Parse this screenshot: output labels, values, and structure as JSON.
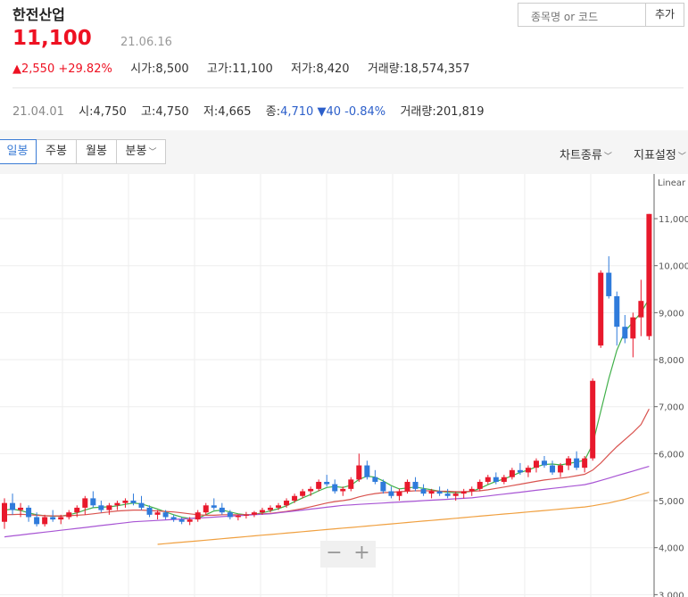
{
  "header": {
    "stock_name": "한전산업",
    "price": "11,100",
    "date": "21.06.16",
    "change": "2,550",
    "change_pct": "+29.82%",
    "open_label": "시가",
    "open": "8,500",
    "high_label": "고가",
    "high": "11,100",
    "low_label": "저가",
    "low": "8,420",
    "volume_label": "거래량",
    "volume": "18,574,357",
    "up_color": "#e8192c"
  },
  "search": {
    "placeholder": "종목명 or 코드",
    "add_label": "추가"
  },
  "hover_row": {
    "date": "21.04.01",
    "open_label": "시",
    "open": "4,750",
    "high_label": "고",
    "high": "4,750",
    "low_label": "저",
    "low": "4,665",
    "close_label": "종",
    "close": "4,710",
    "change": "40",
    "change_pct": "-0.84%",
    "volume_label": "거래량",
    "volume": "201,819",
    "down_color": "#2c5fca"
  },
  "tabs": [
    {
      "label": "일봉",
      "active": true
    },
    {
      "label": "주봉",
      "active": false
    },
    {
      "label": "월봉",
      "active": false
    },
    {
      "label": "분봉",
      "active": false
    }
  ],
  "dropdowns": {
    "chart_type": "차트종류",
    "indicators": "지표설정"
  },
  "chart_data": {
    "type": "candlestick",
    "scale_label": "Linear",
    "y_ticks": [
      3000,
      4000,
      5000,
      6000,
      7000,
      8000,
      9000,
      10000,
      11000
    ],
    "y_tick_labels": [
      "3,000",
      "4,000",
      "5,000",
      "6,000",
      "7,000",
      "8,000",
      "9,000",
      "10,000",
      "11,000"
    ],
    "ylim": [
      2950,
      11950
    ],
    "grid": true,
    "up_color": "#e8192c",
    "down_color": "#2f7bdb",
    "candles": [
      [
        4550,
        5050,
        4400,
        4950
      ],
      [
        4950,
        5150,
        4700,
        4800
      ],
      [
        4800,
        4950,
        4650,
        4850
      ],
      [
        4850,
        4900,
        4550,
        4650
      ],
      [
        4650,
        4750,
        4450,
        4500
      ],
      [
        4500,
        4700,
        4450,
        4650
      ],
      [
        4650,
        4800,
        4550,
        4600
      ],
      [
        4600,
        4700,
        4500,
        4650
      ],
      [
        4650,
        4800,
        4600,
        4750
      ],
      [
        4750,
        4900,
        4650,
        4850
      ],
      [
        4850,
        5100,
        4700,
        5050
      ],
      [
        5050,
        5200,
        4850,
        4900
      ],
      [
        4900,
        5000,
        4750,
        4800
      ],
      [
        4800,
        4950,
        4700,
        4900
      ],
      [
        4900,
        5000,
        4800,
        4950
      ],
      [
        4950,
        5050,
        4850,
        5000
      ],
      [
        5000,
        5150,
        4900,
        4950
      ],
      [
        4950,
        5100,
        4800,
        4850
      ],
      [
        4850,
        4900,
        4650,
        4700
      ],
      [
        4700,
        4800,
        4600,
        4750
      ],
      [
        4750,
        4800,
        4600,
        4650
      ],
      [
        4650,
        4700,
        4550,
        4600
      ],
      [
        4600,
        4650,
        4500,
        4550
      ],
      [
        4550,
        4650,
        4480,
        4600
      ],
      [
        4600,
        4800,
        4550,
        4750
      ],
      [
        4750,
        4950,
        4700,
        4900
      ],
      [
        4900,
        5050,
        4800,
        4850
      ],
      [
        4850,
        4950,
        4700,
        4750
      ],
      [
        4750,
        4800,
        4600,
        4650
      ],
      [
        4650,
        4700,
        4580,
        4680
      ],
      [
        4680,
        4760,
        4620,
        4700
      ],
      [
        4700,
        4780,
        4650,
        4750
      ],
      [
        4750,
        4850,
        4700,
        4800
      ],
      [
        4800,
        4900,
        4750,
        4850
      ],
      [
        4850,
        4950,
        4800,
        4900
      ],
      [
        4900,
        5050,
        4850,
        5000
      ],
      [
        5000,
        5150,
        4950,
        5100
      ],
      [
        5100,
        5250,
        5050,
        5200
      ],
      [
        5200,
        5300,
        5100,
        5250
      ],
      [
        5250,
        5450,
        5200,
        5400
      ],
      [
        5400,
        5550,
        5300,
        5350
      ],
      [
        5350,
        5450,
        5150,
        5200
      ],
      [
        5200,
        5300,
        5100,
        5250
      ],
      [
        5250,
        5500,
        5200,
        5450
      ],
      [
        5450,
        6000,
        5400,
        5750
      ],
      [
        5750,
        5850,
        5450,
        5500
      ],
      [
        5500,
        5650,
        5350,
        5400
      ],
      [
        5400,
        5450,
        5150,
        5200
      ],
      [
        5200,
        5300,
        5050,
        5100
      ],
      [
        5100,
        5250,
        5000,
        5200
      ],
      [
        5200,
        5450,
        5150,
        5400
      ],
      [
        5400,
        5500,
        5200,
        5250
      ],
      [
        5250,
        5350,
        5100,
        5150
      ],
      [
        5150,
        5250,
        5050,
        5200
      ],
      [
        5200,
        5300,
        5100,
        5150
      ],
      [
        5150,
        5250,
        5050,
        5100
      ],
      [
        5100,
        5200,
        5000,
        5150
      ],
      [
        5150,
        5250,
        5050,
        5200
      ],
      [
        5200,
        5300,
        5100,
        5250
      ],
      [
        5250,
        5450,
        5200,
        5400
      ],
      [
        5400,
        5550,
        5350,
        5500
      ],
      [
        5500,
        5600,
        5350,
        5400
      ],
      [
        5400,
        5550,
        5350,
        5500
      ],
      [
        5500,
        5700,
        5450,
        5650
      ],
      [
        5650,
        5800,
        5550,
        5600
      ],
      [
        5600,
        5750,
        5500,
        5700
      ],
      [
        5700,
        5900,
        5600,
        5850
      ],
      [
        5850,
        5950,
        5700,
        5750
      ],
      [
        5750,
        5850,
        5550,
        5600
      ],
      [
        5600,
        5800,
        5500,
        5750
      ],
      [
        5750,
        5950,
        5650,
        5900
      ],
      [
        5900,
        6050,
        5650,
        5700
      ],
      [
        5700,
        5950,
        5600,
        5900
      ],
      [
        5900,
        7600,
        5850,
        7550
      ],
      [
        8300,
        9900,
        8250,
        9850
      ],
      [
        9850,
        10200,
        9300,
        9350
      ],
      [
        9350,
        9450,
        8300,
        8700
      ],
      [
        8700,
        8950,
        8350,
        8450
      ],
      [
        8450,
        9000,
        8050,
        8900
      ],
      [
        8900,
        9700,
        8500,
        9250
      ],
      [
        8500,
        11100,
        8420,
        11100
      ]
    ],
    "ma_colors": [
      "#41b04a",
      "#d9534f",
      "#a855d4",
      "#f0a040"
    ],
    "moving_averages": [
      [
        4800,
        4820,
        4790,
        4740,
        4700,
        4680,
        4670,
        4670,
        4700,
        4740,
        4800,
        4850,
        4860,
        4870,
        4890,
        4920,
        4950,
        4930,
        4880,
        4820,
        4760,
        4700,
        4650,
        4620,
        4630,
        4700,
        4780,
        4800,
        4760,
        4720,
        4700,
        4710,
        4740,
        4780,
        4830,
        4890,
        4980,
        5060,
        5130,
        5210,
        5280,
        5300,
        5280,
        5330,
        5450,
        5520,
        5500,
        5420,
        5320,
        5250,
        5270,
        5290,
        5260,
        5230,
        5200,
        5180,
        5170,
        5180,
        5200,
        5260,
        5340,
        5410,
        5460,
        5530,
        5600,
        5650,
        5720,
        5770,
        5780,
        5760,
        5790,
        5820,
        5860,
        6200,
        6900,
        7600,
        8200,
        8600,
        8800,
        9000,
        9300
      ],
      [
        4700,
        4705,
        4710,
        4700,
        4690,
        4680,
        4675,
        4675,
        4680,
        4690,
        4700,
        4720,
        4740,
        4760,
        4780,
        4790,
        4800,
        4800,
        4790,
        4780,
        4770,
        4760,
        4740,
        4720,
        4700,
        4690,
        4690,
        4700,
        4700,
        4700,
        4700,
        4710,
        4720,
        4730,
        4750,
        4770,
        4800,
        4830,
        4870,
        4910,
        4950,
        4980,
        5000,
        5030,
        5080,
        5120,
        5150,
        5170,
        5180,
        5190,
        5200,
        5210,
        5210,
        5210,
        5200,
        5200,
        5190,
        5190,
        5200,
        5210,
        5230,
        5260,
        5290,
        5320,
        5350,
        5380,
        5410,
        5440,
        5460,
        5480,
        5500,
        5530,
        5560,
        5650,
        5800,
        5980,
        6150,
        6300,
        6450,
        6620,
        6950
      ],
      [
        4230,
        4250,
        4270,
        4290,
        4310,
        4330,
        4350,
        4370,
        4390,
        4410,
        4430,
        4450,
        4470,
        4490,
        4510,
        4530,
        4550,
        4560,
        4570,
        4580,
        4590,
        4600,
        4610,
        4620,
        4630,
        4640,
        4650,
        4660,
        4670,
        4680,
        4690,
        4700,
        4710,
        4720,
        4740,
        4760,
        4780,
        4800,
        4820,
        4840,
        4860,
        4880,
        4900,
        4910,
        4920,
        4930,
        4940,
        4950,
        4960,
        4970,
        4980,
        4990,
        5000,
        5010,
        5020,
        5030,
        5040,
        5050,
        5060,
        5080,
        5100,
        5120,
        5140,
        5160,
        5180,
        5200,
        5220,
        5240,
        5260,
        5280,
        5300,
        5320,
        5340,
        5380,
        5430,
        5480,
        5530,
        5580,
        5630,
        5680,
        5730
      ],
      [
        null,
        null,
        null,
        null,
        null,
        null,
        null,
        null,
        null,
        null,
        null,
        null,
        null,
        null,
        null,
        null,
        null,
        null,
        null,
        4070,
        4085,
        4100,
        4115,
        4130,
        4145,
        4160,
        4175,
        4190,
        4205,
        4220,
        4235,
        4250,
        4265,
        4280,
        4295,
        4310,
        4325,
        4340,
        4355,
        4370,
        4385,
        4400,
        4415,
        4430,
        4445,
        4460,
        4475,
        4490,
        4505,
        4520,
        4535,
        4550,
        4565,
        4580,
        4595,
        4610,
        4625,
        4640,
        4655,
        4670,
        4685,
        4700,
        4715,
        4730,
        4745,
        4760,
        4775,
        4790,
        4805,
        4820,
        4835,
        4850,
        4865,
        4890,
        4920,
        4950,
        4990,
        5030,
        5080,
        5130,
        5180
      ]
    ]
  }
}
